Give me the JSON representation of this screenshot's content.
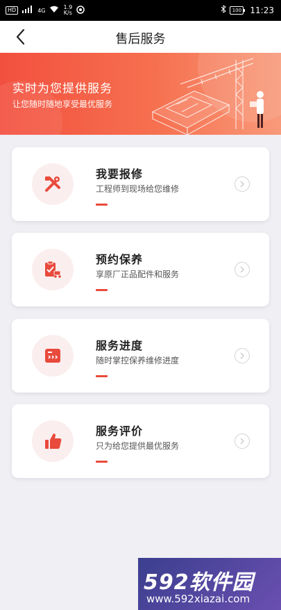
{
  "status_bar": {
    "hd": "HD",
    "signal": "4G",
    "speed_value": "1.9",
    "speed_unit": "K/s",
    "battery": "100",
    "time": "11:23"
  },
  "nav": {
    "title": "售后服务"
  },
  "banner": {
    "title": "实时为您提供服务",
    "subtitle": "让您随时随地享受最优服务"
  },
  "cards": [
    {
      "title": "我要报修",
      "subtitle": "工程师到现场给您维修",
      "icon": "wrench-screwdriver-icon"
    },
    {
      "title": "预约保养",
      "subtitle": "享原厂正品配件和服务",
      "icon": "clipboard-truck-icon"
    },
    {
      "title": "服务进度",
      "subtitle": "随时掌控保养维修进度",
      "icon": "progress-window-icon"
    },
    {
      "title": "服务评价",
      "subtitle": "只为给您提供最优服务",
      "icon": "thumbs-up-icon"
    }
  ],
  "accent_color": "#e84a3c",
  "watermark": {
    "brand": "592软件园",
    "url": "www.592xiazai.com"
  }
}
